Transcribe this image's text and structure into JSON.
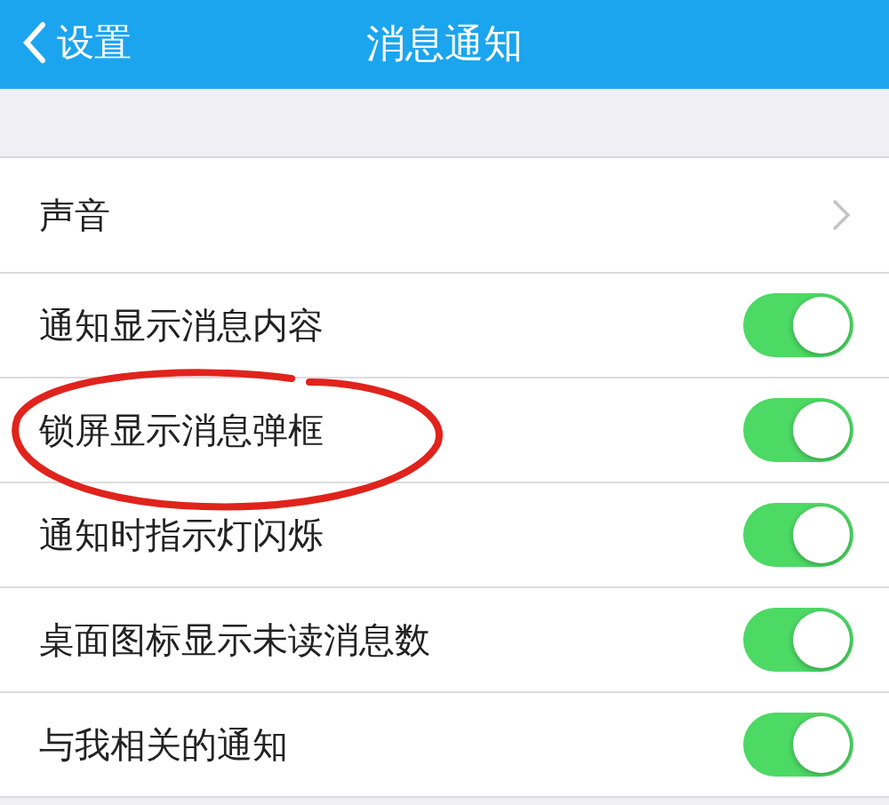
{
  "header": {
    "back": "设置",
    "title": "消息通知"
  },
  "rows": [
    {
      "kind": "link",
      "label": "声音",
      "circled": false
    },
    {
      "kind": "toggle",
      "label": "通知显示消息内容",
      "on": true,
      "circled": false
    },
    {
      "kind": "toggle",
      "label": "锁屏显示消息弹框",
      "on": true,
      "circled": true
    },
    {
      "kind": "toggle",
      "label": "通知时指示灯闪烁",
      "on": true,
      "circled": false
    },
    {
      "kind": "toggle",
      "label": "桌面图标显示未读消息数",
      "on": true,
      "circled": false
    },
    {
      "kind": "toggle",
      "label": "与我相关的通知",
      "on": true,
      "circled": false
    }
  ]
}
